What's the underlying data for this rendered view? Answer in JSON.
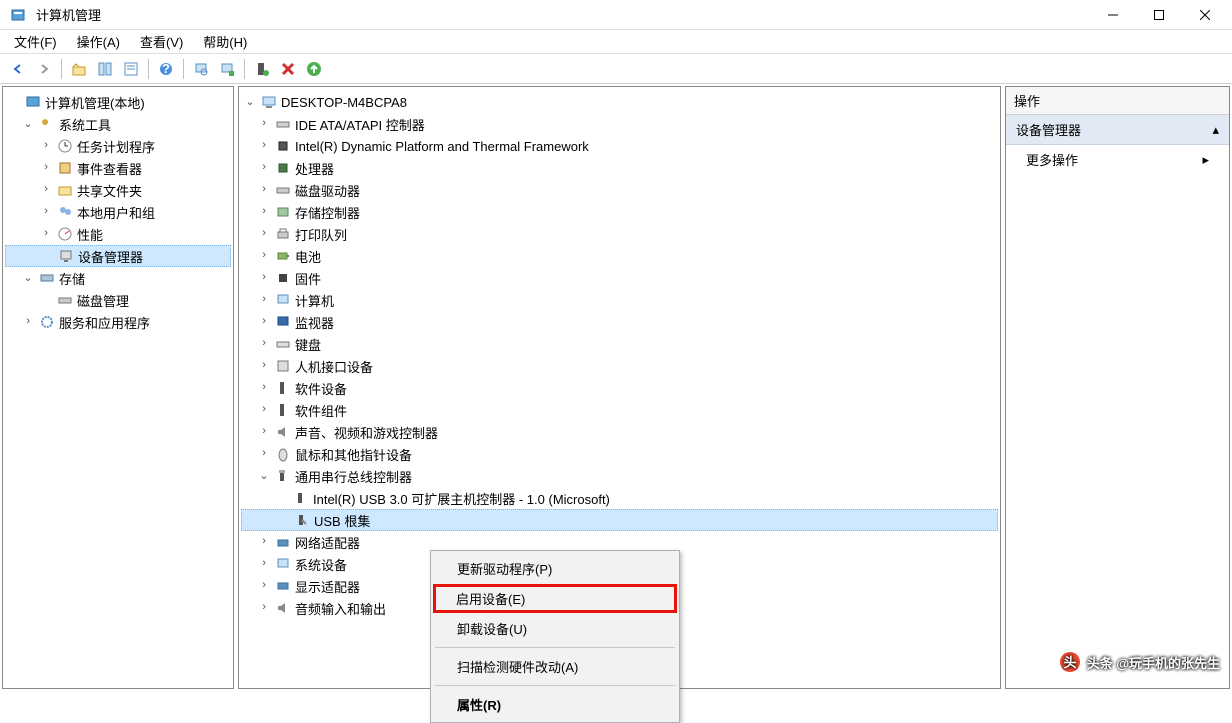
{
  "title_bar": {
    "title": "计算机管理"
  },
  "menu": {
    "file": "文件(F)",
    "action": "操作(A)",
    "view": "查看(V)",
    "help": "帮助(H)"
  },
  "left_tree": {
    "root": "计算机管理(本地)",
    "system_tools": "系统工具",
    "task_scheduler": "任务计划程序",
    "event_viewer": "事件查看器",
    "shared_folders": "共享文件夹",
    "local_users": "本地用户和组",
    "performance": "性能",
    "device_manager": "设备管理器",
    "storage": "存储",
    "disk_management": "磁盘管理",
    "services_apps": "服务和应用程序"
  },
  "center_tree": {
    "computer": "DESKTOP-M4BCPA8",
    "ide": "IDE ATA/ATAPI 控制器",
    "intel_thermal": "Intel(R) Dynamic Platform and Thermal Framework",
    "cpu": "处理器",
    "disk_drives": "磁盘驱动器",
    "storage_ctrl": "存储控制器",
    "print_queue": "打印队列",
    "battery": "电池",
    "firmware": "固件",
    "computer_node": "计算机",
    "monitor": "监视器",
    "keyboard": "键盘",
    "hid": "人机接口设备",
    "software_dev": "软件设备",
    "software_comp": "软件组件",
    "sound": "声音、视频和游戏控制器",
    "mouse": "鼠标和其他指针设备",
    "usb_ctrl": "通用串行总线控制器",
    "usb_host": "Intel(R) USB 3.0 可扩展主机控制器 - 1.0 (Microsoft)",
    "usb_root_hub": "USB 根集",
    "network": "网络适配器",
    "system_dev": "系统设备",
    "display_adapter": "显示适配器",
    "audio_io": "音频输入和输出"
  },
  "ctx": {
    "update_driver": "更新驱动程序(P)",
    "enable_device": "启用设备(E)",
    "uninstall": "卸载设备(U)",
    "scan_hw": "扫描检测硬件改动(A)",
    "properties": "属性(R)"
  },
  "right_panel": {
    "header": "操作",
    "category": "设备管理器",
    "more": "更多操作"
  },
  "watermark": "头条 @玩手机的张先生"
}
